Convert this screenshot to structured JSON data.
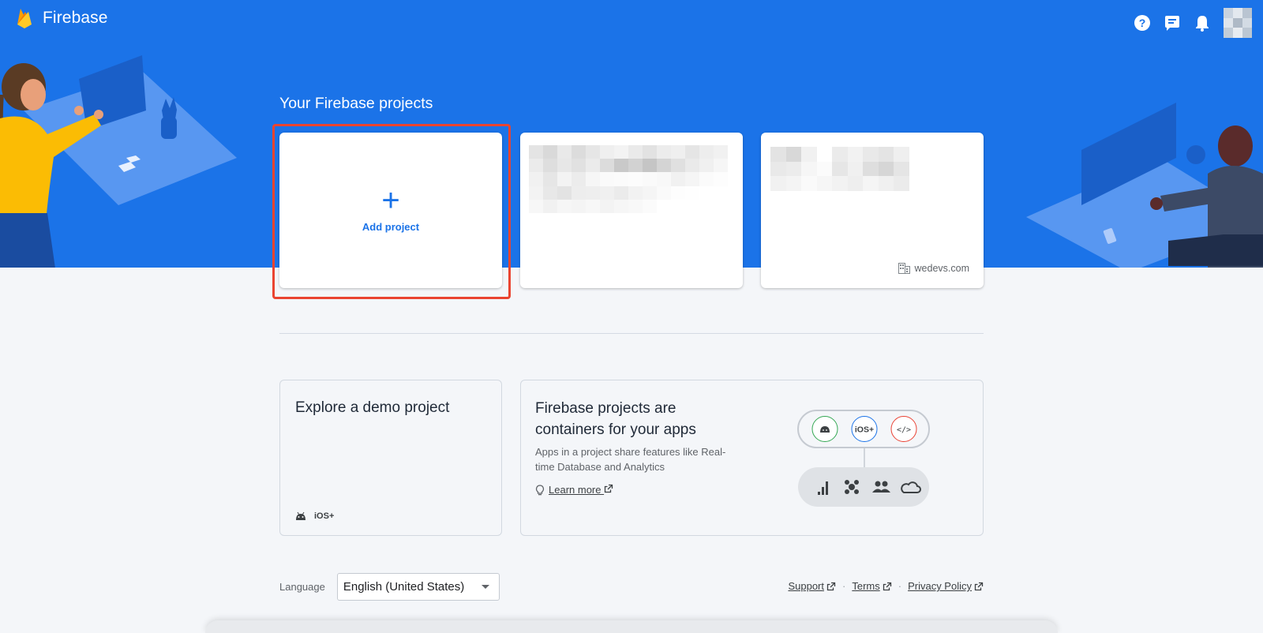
{
  "header": {
    "app_name": "Firebase",
    "icons": [
      "help-icon",
      "feedback-icon",
      "notifications-icon",
      "account-avatar"
    ]
  },
  "projects": {
    "title": "Your Firebase projects",
    "add_label": "Add project",
    "add_symbol": "+",
    "cards": [
      {
        "redacted": true
      },
      {
        "redacted": true,
        "organization": "wedevs.com"
      }
    ]
  },
  "demo": {
    "title": "Explore a demo project",
    "platforms": [
      "android-icon",
      "iOS+"
    ]
  },
  "explain": {
    "title": "Firebase projects are containers for your apps",
    "description": "Apps in a project share features like Real-time Database and Analytics",
    "learn_more": "Learn more",
    "platforms": [
      "android-icon",
      "iOS+",
      "web-code-icon"
    ],
    "features": [
      "analytics-icon",
      "crashlytics-icon",
      "users-icon",
      "cloud-icon"
    ]
  },
  "footer": {
    "language_label": "Language",
    "language_value": "English (United States)",
    "links": [
      "Support",
      "Terms",
      "Privacy Policy"
    ]
  },
  "colors": {
    "brand_blue": "#1b73e8",
    "highlight_red": "#ea4430",
    "page_bg": "#f4f6f9"
  }
}
